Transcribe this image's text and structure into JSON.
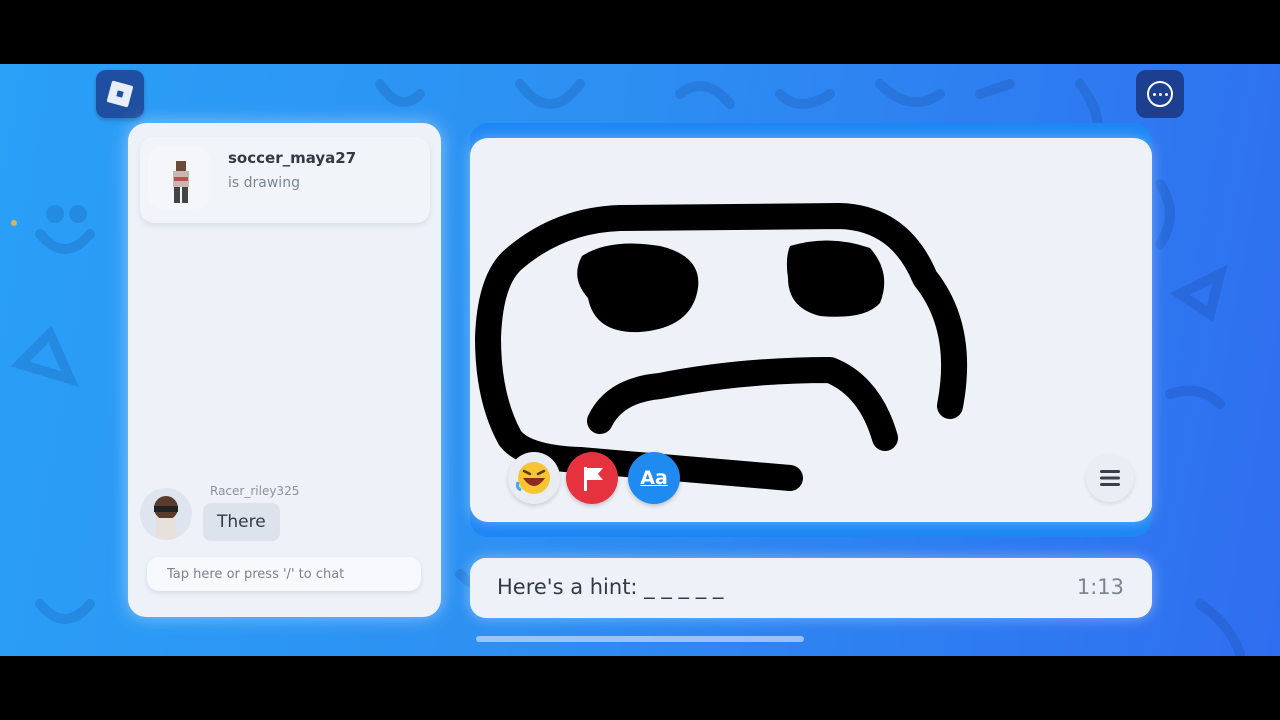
{
  "topbar": {
    "logo_icon": "roblox-logo-icon",
    "menu_icon": "more-options-icon"
  },
  "drawer": {
    "username": "soccer_maya27",
    "status": "is drawing"
  },
  "chat": {
    "messages": [
      {
        "user": "Racer_riley325",
        "text": "There"
      }
    ],
    "input_placeholder": "Tap here or press '/' to chat"
  },
  "canvas": {
    "tools": [
      {
        "name": "reactions",
        "icon": "laughing-emoji-icon"
      },
      {
        "name": "report",
        "icon": "flag-icon"
      },
      {
        "name": "guess",
        "icon": "text-aa-icon",
        "label": "Aa"
      }
    ],
    "menu_icon": "hamburger-menu-icon",
    "stroke_color": "#000000"
  },
  "hint": {
    "label": "Here's a hint: _ _ _ _ _",
    "timer": "1:13"
  },
  "colors": {
    "accent": "#2d8ff2",
    "panel": "#eef2f8",
    "flag_red": "#e6323f",
    "guess_blue": "#1f8af0"
  }
}
